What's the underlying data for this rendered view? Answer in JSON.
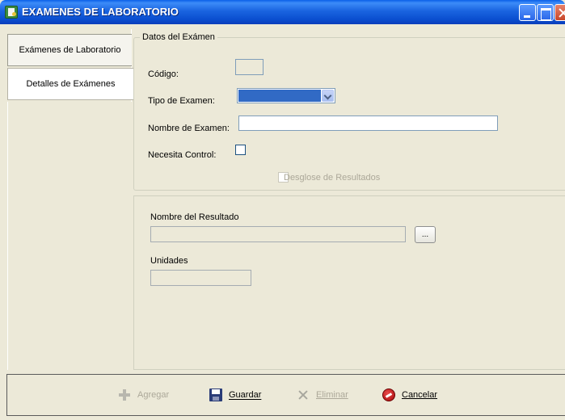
{
  "window": {
    "title": "EXAMENES DE LABORATORIO"
  },
  "tabs": [
    {
      "label": "Exámenes de Laboratorio"
    },
    {
      "label": "Detalles de Exámenes"
    }
  ],
  "datos": {
    "legend": "Datos del Exámen",
    "codigo_label": "Código:",
    "codigo_value": "",
    "tipo_label": "Tipo de Examen:",
    "tipo_value": "",
    "nombre_label": "Nombre de Examen:",
    "nombre_value": "",
    "control_label": "Necesita Control:",
    "desglose_label": "Desglose de Resultados"
  },
  "resultados": {
    "nombre_label": "Nombre del Resultado",
    "nombre_value": "",
    "browse_label": "...",
    "unidades_label": "Unidades",
    "unidades_value": ""
  },
  "toolbar": {
    "agregar_label": "Agregar",
    "guardar_label": "Guardar",
    "eliminar_label": "Eliminar",
    "cancelar_label": "Cancelar"
  }
}
